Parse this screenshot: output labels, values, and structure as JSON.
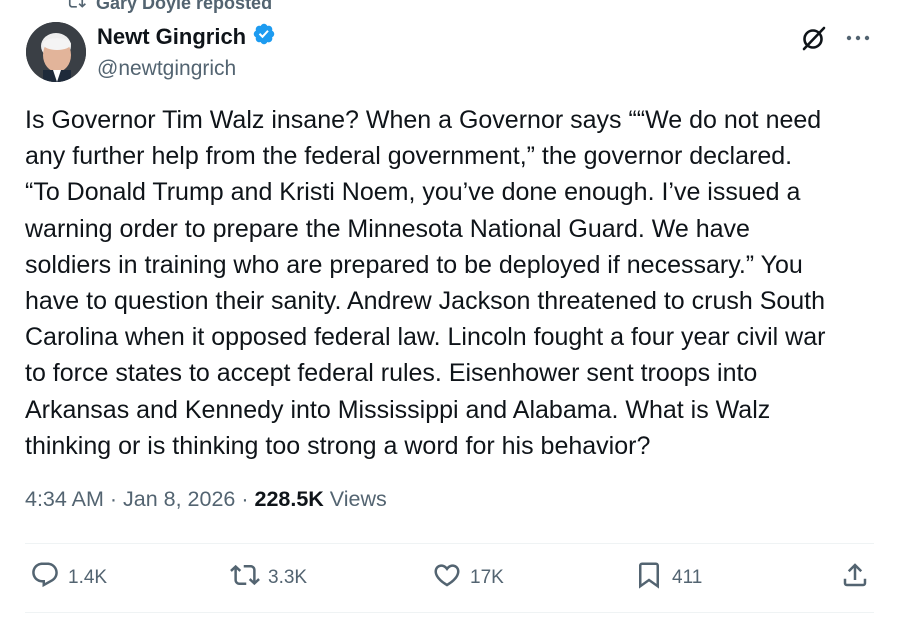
{
  "repost": {
    "text": "Gary Doyle reposted",
    "icon": "repost-icon"
  },
  "author": {
    "display_name": "Newt Gingrich",
    "handle": "@newtgingrich",
    "verified": true,
    "verified_color": "#1d9bf0"
  },
  "top_actions": {
    "grok_icon": "grok-icon",
    "more_icon": "more-icon"
  },
  "tweet": {
    "text": "Is Governor Tim Walz insane? When a Governor says ““We do not need\nany further help from the federal government,” the governor declared.\n“To Donald Trump and Kristi Noem, you’ve done enough. I’ve issued a\nwarning order to prepare the Minnesota National Guard. We have\nsoldiers in training who are prepared to be deployed if necessary.” You\nhave to question their sanity. Andrew Jackson threatened to crush South\nCarolina when it opposed  federal law. Lincoln fought a four year civil war\nto force states to accept federal rules. Eisenhower sent troops into\nArkansas and Kennedy into Mississippi and Alabama. What is Walz\nthinking or is thinking too strong a word for his behavior?"
  },
  "meta": {
    "time": "4:34 AM",
    "separator": " · ",
    "date": "Jan 8, 2026",
    "views_count": "228.5K",
    "views_label": " Views"
  },
  "actions": {
    "replies": "1.4K",
    "reposts": "3.3K",
    "likes": "17K",
    "bookmarks": "411"
  },
  "colors": {
    "text": "#0f1419",
    "secondary": "#536471",
    "divider": "#eff3f4"
  }
}
